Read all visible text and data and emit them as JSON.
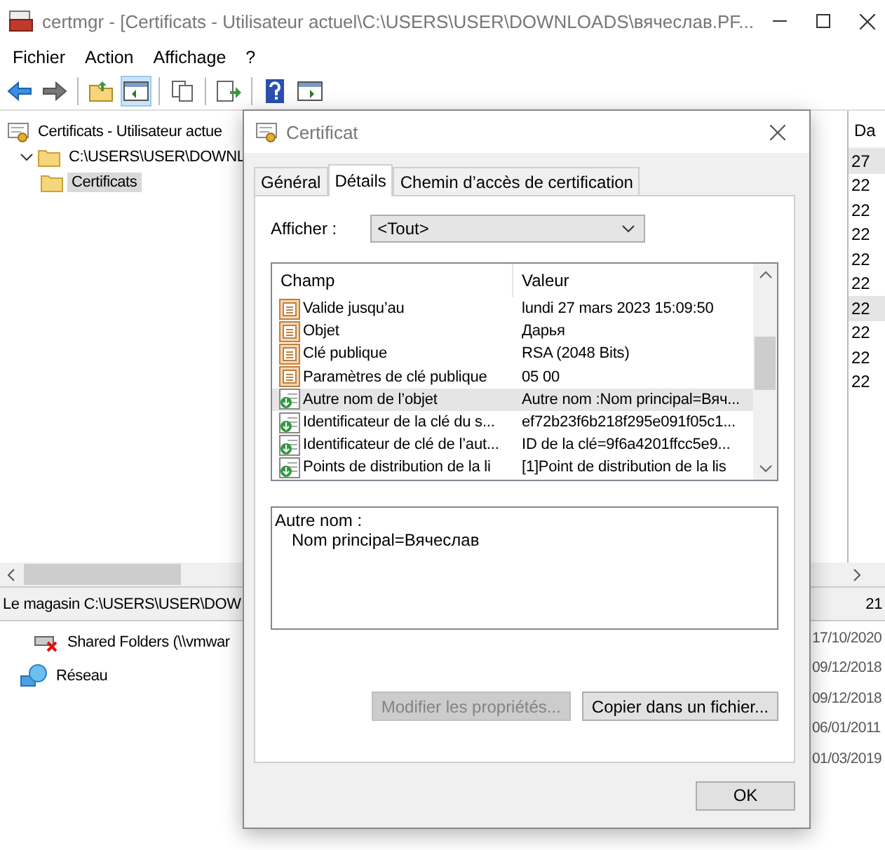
{
  "main_window": {
    "title": "certmgr - [Certificats - Utilisateur actuel\\C:\\USERS\\USER\\DOWNLOADS\\вячеслав.PF...",
    "menu": [
      "Fichier",
      "Action",
      "Affichage",
      "?"
    ],
    "tree": [
      {
        "label": "Certificats - Utilisateur actue",
        "selected": false,
        "children": [
          {
            "label": "C:\\USERS\\USER\\DOWNL",
            "selected": false,
            "expanded": true,
            "children": [
              {
                "label": "Certificats",
                "selected": true
              }
            ]
          }
        ]
      }
    ],
    "right_column": {
      "header": "Da",
      "rows": [
        {
          "text": "27",
          "selected": true
        },
        {
          "text": "22",
          "selected": false
        },
        {
          "text": "22",
          "selected": false
        },
        {
          "text": "22",
          "selected": false
        },
        {
          "text": "22",
          "selected": false
        },
        {
          "text": "22",
          "selected": false
        },
        {
          "text": "22",
          "selected": true
        },
        {
          "text": "22",
          "selected": false
        },
        {
          "text": "22",
          "selected": false
        },
        {
          "text": "22",
          "selected": false
        }
      ]
    },
    "status_bar": {
      "text": "Le magasin C:\\USERS\\USER\\DOW",
      "fragment": "21"
    }
  },
  "background_window": {
    "items": [
      {
        "label": "Shared Folders (\\\\vmwar",
        "kind": "drive"
      },
      {
        "label": "Réseau",
        "kind": "network"
      }
    ],
    "dates": [
      "17/10/2020",
      "09/12/2018",
      "09/12/2018",
      "06/01/2011",
      "01/03/2019"
    ]
  },
  "dialog": {
    "title": "Certificat",
    "tabs": [
      {
        "label": "Général",
        "selected": false
      },
      {
        "label": "Détails",
        "selected": true
      },
      {
        "label": "Chemin d’accès de certification",
        "selected": false
      }
    ],
    "show_label": "Afficher :",
    "show_value": "<Tout>",
    "columns": [
      "Champ",
      "Valeur"
    ],
    "rows": [
      {
        "field": "Valide jusqu’au",
        "value": "lundi 27 mars 2023 15:09:50",
        "kind": "property",
        "selected": false
      },
      {
        "field": "Objet",
        "value": "Дарья",
        "kind": "property",
        "selected": false
      },
      {
        "field": "Clé publique",
        "value": "RSA (2048 Bits)",
        "kind": "property",
        "selected": false
      },
      {
        "field": "Paramètres de clé publique",
        "value": "05 00",
        "kind": "property",
        "selected": false
      },
      {
        "field": "Autre nom de l’objet",
        "value": "Autre nom :Nom principal=Вяч...",
        "kind": "extension",
        "selected": true
      },
      {
        "field": "Identificateur de la clé du s...",
        "value": "ef72b23f6b218f295e091f05c1...",
        "kind": "extension",
        "selected": false
      },
      {
        "field": "Identificateur de clé de l’aut...",
        "value": "ID de la clé=9f6a4201ffcc5e9...",
        "kind": "extension",
        "selected": false
      },
      {
        "field": "Points de distribution de la li",
        "value": "[1]Point de distribution de la lis",
        "kind": "extension",
        "selected": false
      }
    ],
    "detail": {
      "heading": "Autre nom :",
      "value": "Nom principal=Вячеслав"
    },
    "buttons": [
      {
        "label": "Modifier les propriétés...",
        "disabled": true
      },
      {
        "label": "Copier dans un fichier...",
        "disabled": false
      }
    ],
    "ok": "OK"
  }
}
